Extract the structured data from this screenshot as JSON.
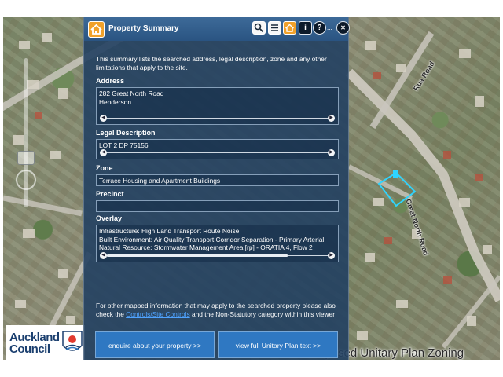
{
  "panel": {
    "title": "Property Summary",
    "intro": "This summary lists the searched address, legal description, zone and any other limitations that apply to the site.",
    "address": {
      "label": "Address",
      "lines": [
        "282 Great North Road",
        "Henderson"
      ]
    },
    "legal": {
      "label": "Legal Description",
      "value": "LOT 2 DP 75156"
    },
    "zone": {
      "label": "Zone",
      "value": "Terrace Housing and Apartment Buildings"
    },
    "precinct": {
      "label": "Precinct",
      "value": ""
    },
    "overlay": {
      "label": "Overlay",
      "lines": [
        "Infrastructure: High Land Transport Route Noise",
        "Built Environment: Air Quality Transport Corridor Separation - Primary Arterial",
        "Natural Resource: Stormwater Management Area [rp] - ORATIA 4, Flow 2"
      ]
    },
    "footer": {
      "before": "For other mapped information that may apply to the searched property please also check the ",
      "link": "Controls/Site Controls",
      "after": " and the Non-Statutory category within this viewer"
    },
    "buttons": {
      "enquire": "enquire about your property >>",
      "view_plan": "view full Unitary Plan text >>"
    }
  },
  "toolbar": {
    "icons": [
      "search-icon",
      "list-icon",
      "property-icon",
      "info-icon",
      "help-icon",
      "more-icon",
      "close-icon"
    ],
    "info_glyph": "i",
    "help_glyph": "?",
    "more_glyph": "...",
    "close_glyph": "✕"
  },
  "map": {
    "caption": "Proposed Unitary Plan Zoning",
    "streets": [
      "Great North Road",
      "Rua Road"
    ],
    "highlight_color": "#2fd4ff"
  },
  "logo": {
    "line1": "Auckland",
    "line2": "Council"
  },
  "colors": {
    "panel": "#224062",
    "header": "#3d6a98",
    "accent": "#f0a12a",
    "button": "#2f78c2",
    "link": "#4fa3ff"
  }
}
